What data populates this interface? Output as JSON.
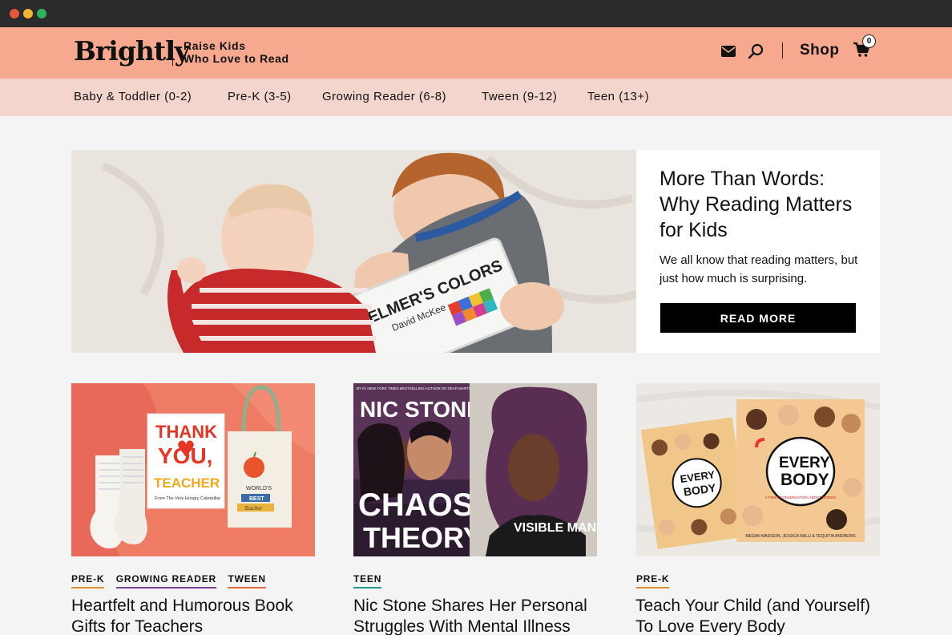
{
  "header": {
    "logo": "Brightly",
    "tagline_line1": "Raise Kids",
    "tagline_line2": "Who Love to Read",
    "shop_label": "Shop",
    "cart_count": "0",
    "icons": [
      "mail-icon",
      "search-icon",
      "cart-icon"
    ]
  },
  "age_nav": [
    "Baby & Toddler (0-2)",
    "Pre-K (3-5)",
    "Growing Reader (6-8)",
    "Tween (9-12)",
    "Teen (13+)"
  ],
  "hero": {
    "title": "More Than Words: Why Reading Matters for Kids",
    "text": "We all know that reading matters, but just how much is surprising.",
    "button": "READ MORE",
    "image_text": {
      "book_title": "ELMER'S COLORS",
      "book_author": "David McKee"
    }
  },
  "cards": [
    {
      "tags": [
        "PRE-K",
        "GROWING READER",
        "TWEEN"
      ],
      "tag_colors": [
        "#e0902a",
        "#7b3f98",
        "#e06a3a"
      ],
      "title": "Heartfelt and Humorous Book Gifts for Teachers",
      "image_text": {
        "card_line1": "THANK",
        "card_line2": "YOU,",
        "card_line3": "TEACHER",
        "card_caption": "From The Very Hungry Caterpillar",
        "bag_line1": "WORLD'S",
        "bag_line2": "BEST",
        "bag_line3": "Teacher"
      }
    },
    {
      "tags": [
        "TEEN"
      ],
      "tag_colors": [
        "#1f9a8a"
      ],
      "title": "Nic Stone Shares Her Personal Struggles With Mental Illness",
      "image_text": {
        "cover_top": "BY #1 NEW YORK TIMES BESTSELLING AUTHOR OF DEAR MARTIN",
        "author": "NIC STONE",
        "book_line1": "CHAOS",
        "book_line2": "THEORY",
        "shirt": "VISIBLE MAN"
      }
    },
    {
      "tags": [
        "PRE-K"
      ],
      "tag_colors": [
        "#e0902a"
      ],
      "title": "Teach Your Child (and Yourself) To Love Every Body",
      "image_text": {
        "book_line1": "EVERY",
        "book_line2": "BODY",
        "book_sub": "A FIRST CONVERSATION ABOUT BODIES",
        "authors": "MEGAN MADISON, JESSICA RALLI & TEQUITIA ANDREWS"
      }
    }
  ],
  "colors": {
    "header_bg": "#f6a98e",
    "nav_bg": "#f3d5ce",
    "page_bg": "#f4f4f4",
    "button_bg": "#000000"
  }
}
